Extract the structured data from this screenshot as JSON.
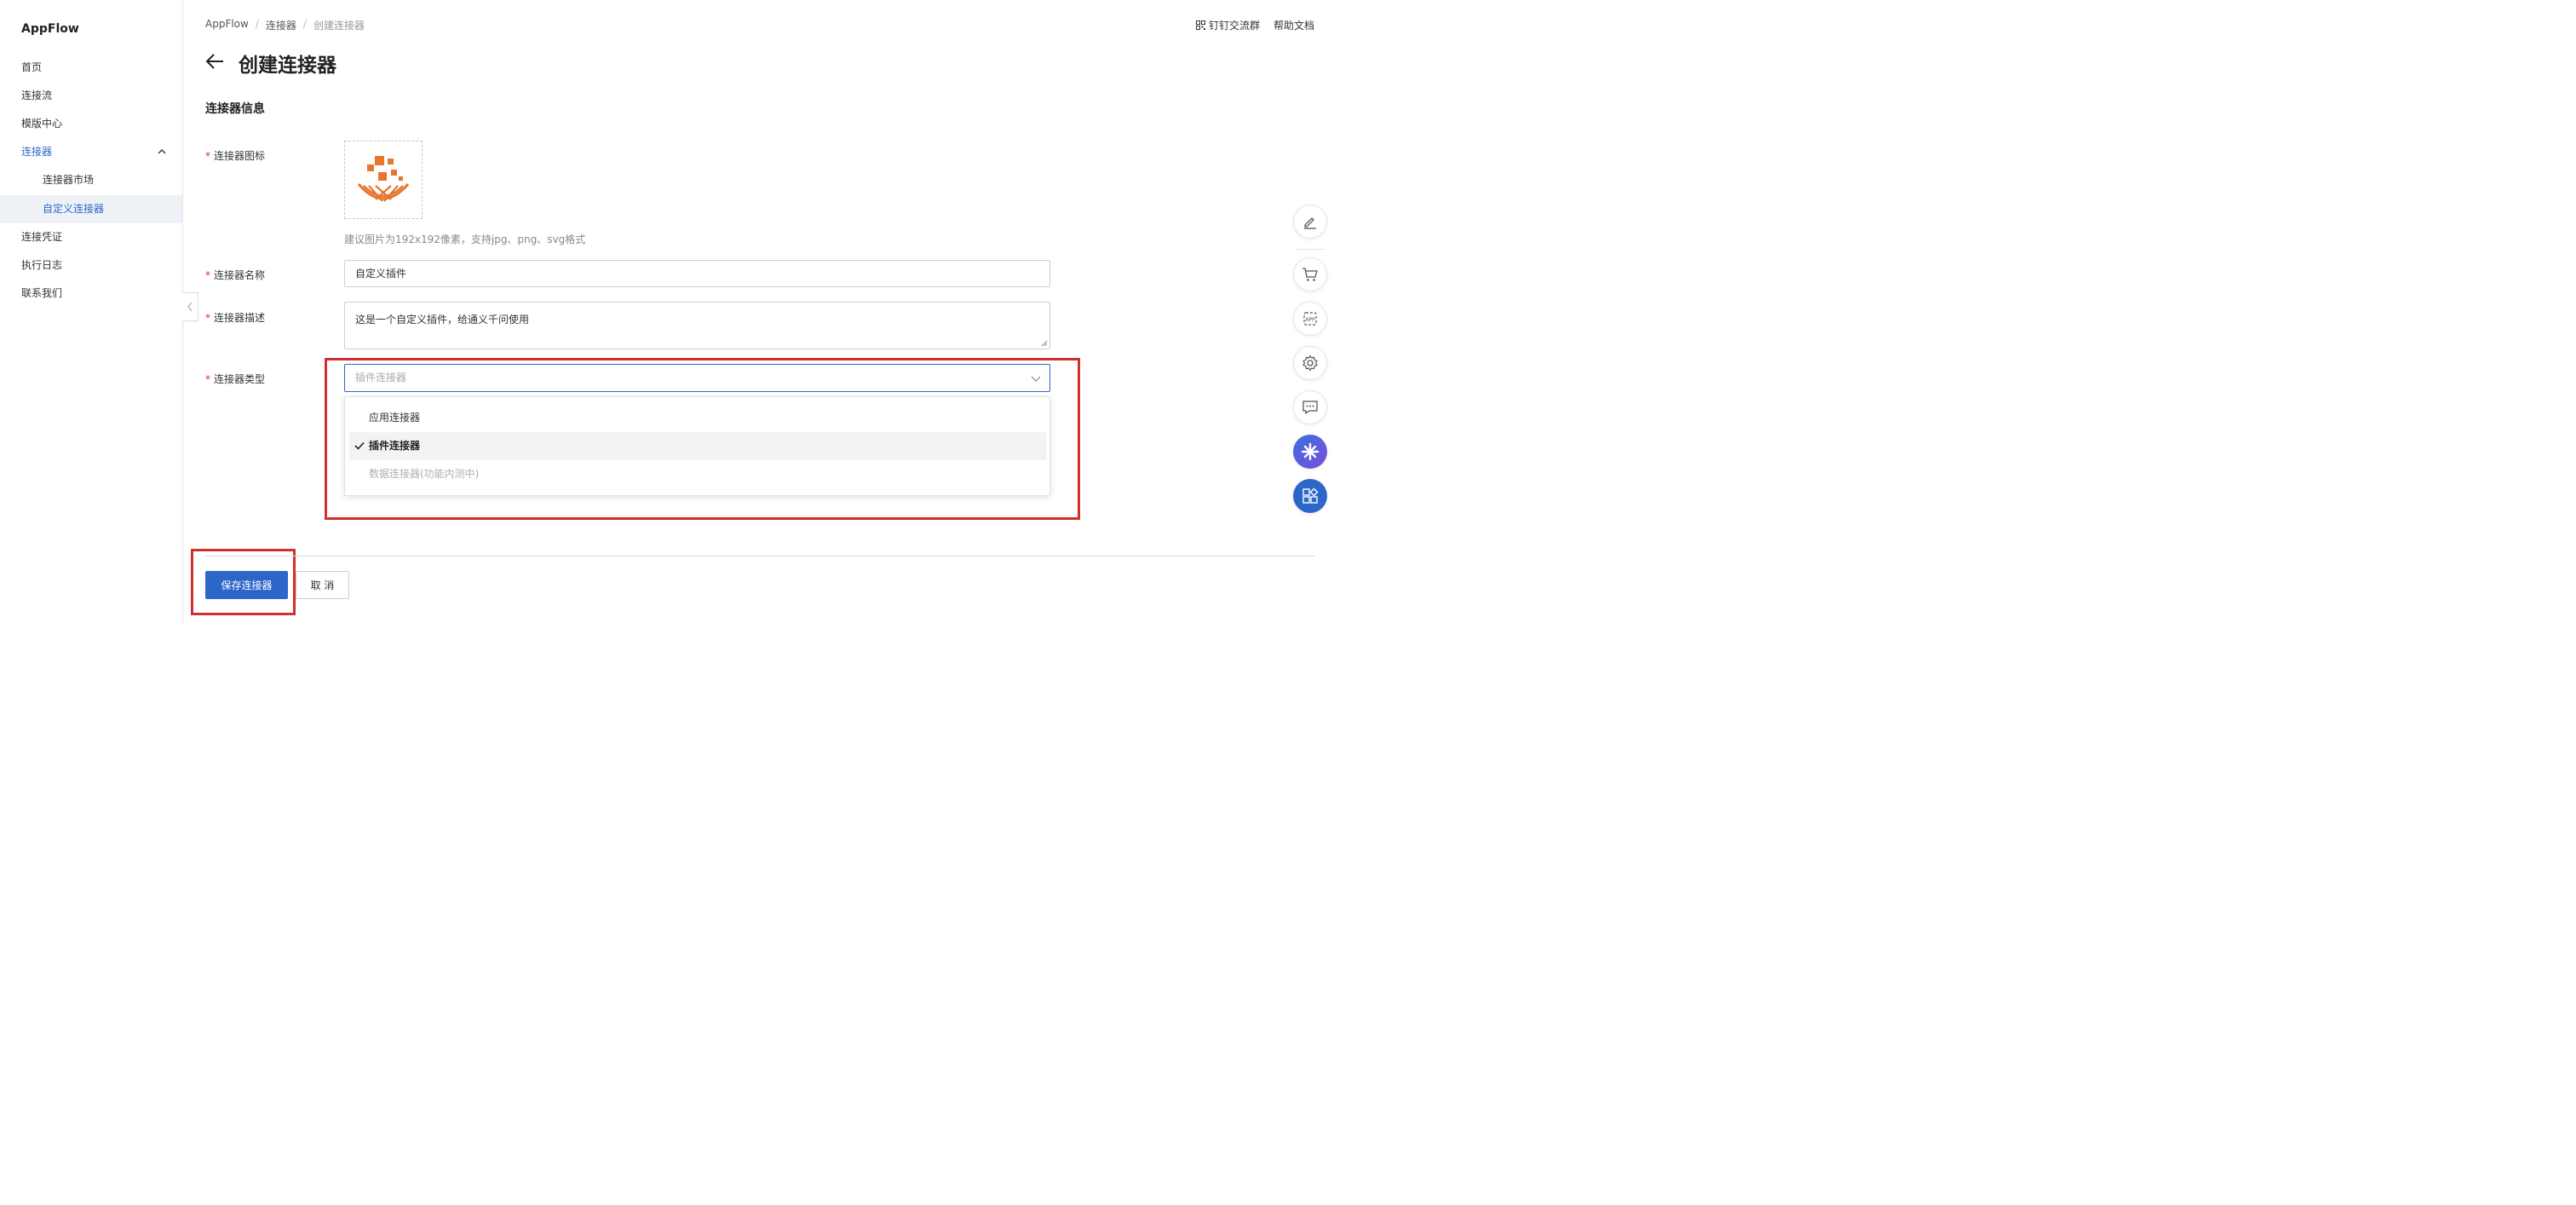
{
  "app": {
    "name": "AppFlow"
  },
  "sidebar": {
    "items": [
      {
        "label": "首页"
      },
      {
        "label": "连接流"
      },
      {
        "label": "模版中心"
      },
      {
        "label": "连接器"
      },
      {
        "label": "连接器市场"
      },
      {
        "label": "自定义连接器"
      },
      {
        "label": "连接凭证"
      },
      {
        "label": "执行日志"
      },
      {
        "label": "联系我们"
      }
    ]
  },
  "breadcrumb": [
    "AppFlow",
    "连接器",
    "创建连接器"
  ],
  "top_links": {
    "dingtalk": "钉钉交流群",
    "help": "帮助文档"
  },
  "page": {
    "title": "创建连接器",
    "section": "连接器信息"
  },
  "form": {
    "icon_label": "连接器图标",
    "icon_hint": "建议图片为192x192像素，支持jpg、png、svg格式",
    "name_label": "连接器名称",
    "name_value": "自定义插件",
    "desc_label": "连接器描述",
    "desc_value": "这是一个自定义插件，给通义千问使用",
    "type_label": "连接器类型",
    "type_placeholder": "插件连接器",
    "type_options": [
      {
        "label": "应用连接器",
        "selected": false,
        "disabled": false
      },
      {
        "label": "插件连接器",
        "selected": true,
        "disabled": false
      },
      {
        "label": "数据连接器(功能内测中)",
        "selected": false,
        "disabled": true
      }
    ]
  },
  "actions": {
    "save": "保存连接器",
    "cancel": "取 消"
  },
  "colors": {
    "accent": "#2d66c9",
    "highlight": "#d0312d",
    "logo": "#e8742f"
  },
  "float_tools": [
    "edit-icon",
    "cart-icon",
    "app-icon",
    "settings-icon",
    "chat-icon",
    "ai-assistant-icon",
    "apps-grid-icon"
  ]
}
